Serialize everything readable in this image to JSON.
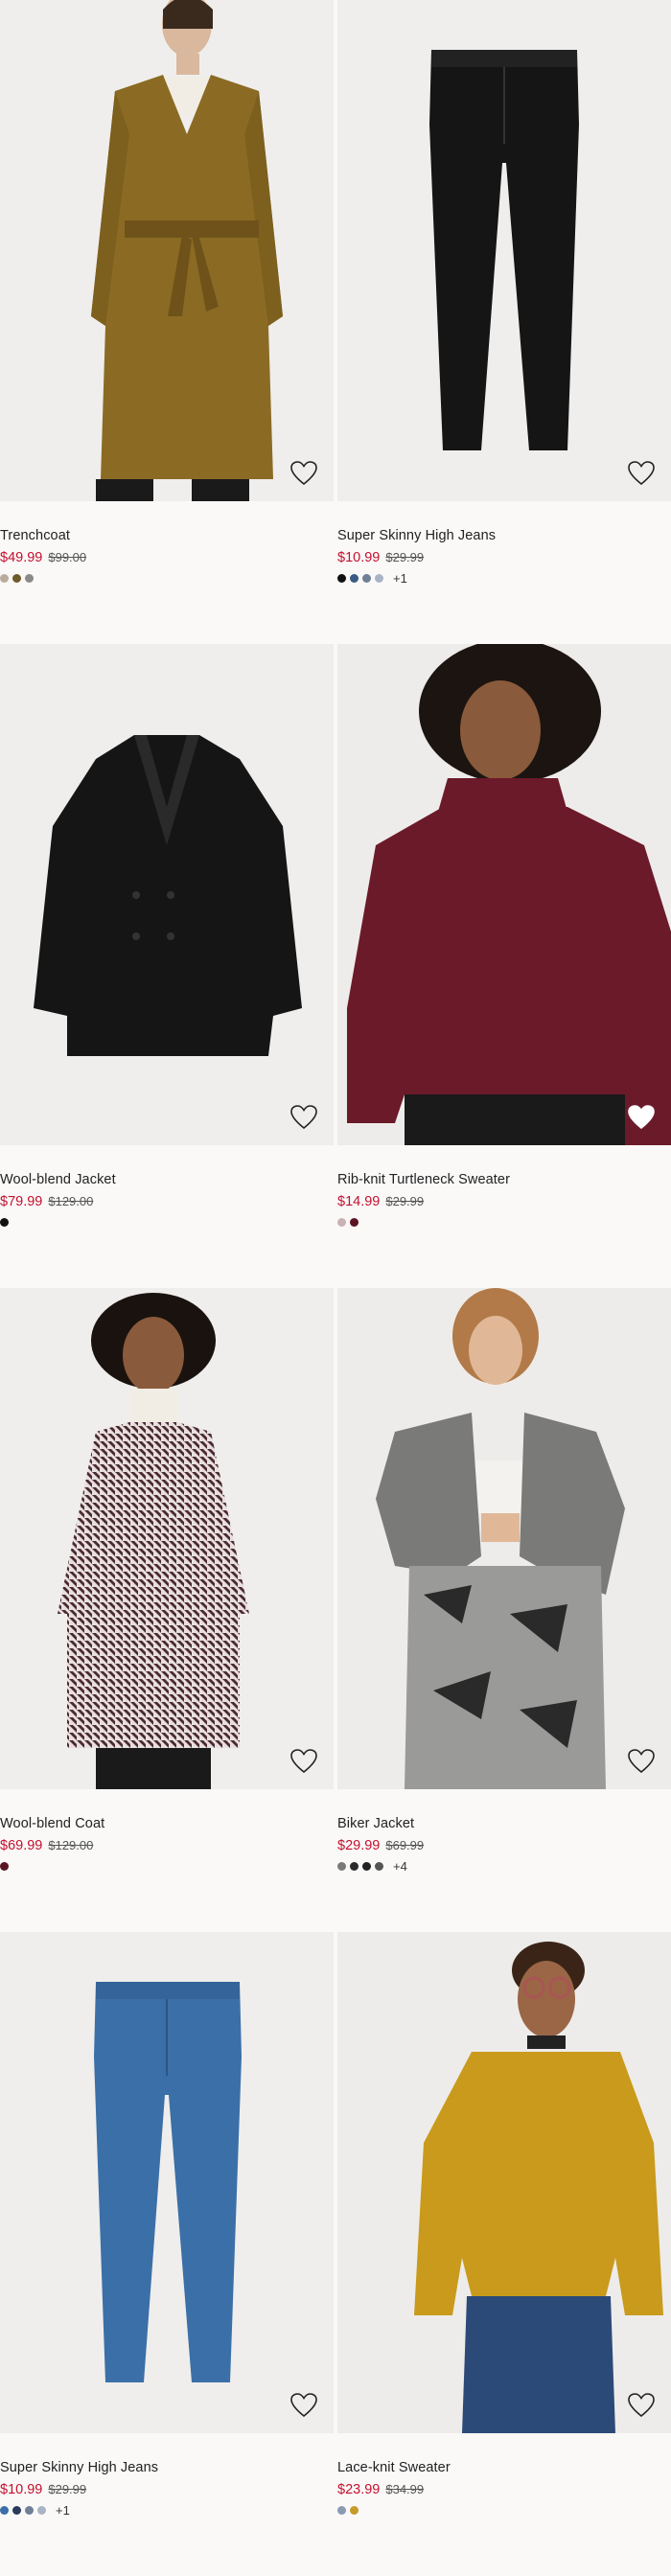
{
  "products": [
    {
      "name": "Trenchcoat",
      "price": "$49.99",
      "old_price": "$99.00",
      "swatches": [
        "#b9ac9c",
        "#6f5a2a",
        "#8a8a86"
      ],
      "more": "",
      "favorited": false,
      "image": "trenchcoat-model-image"
    },
    {
      "name": "Super Skinny High Jeans",
      "price": "$10.99",
      "old_price": "$29.99",
      "swatches": [
        "#111111",
        "#3b5a85",
        "#6f7f96",
        "#a9b4c6"
      ],
      "more": "+1",
      "favorited": false,
      "image": "black-jeans-image"
    },
    {
      "name": "Wool-blend Jacket",
      "price": "$79.99",
      "old_price": "$129.00",
      "swatches": [
        "#111111"
      ],
      "more": "",
      "favorited": false,
      "image": "black-wool-jacket-image"
    },
    {
      "name": "Rib-knit Turtleneck Sweater",
      "price": "$14.99",
      "old_price": "$29.99",
      "swatches": [
        "#c9b2b6",
        "#5a1422"
      ],
      "more": "",
      "favorited": true,
      "image": "burgundy-sweater-model-image"
    },
    {
      "name": "Wool-blend Coat",
      "price": "$69.99",
      "old_price": "$129.00",
      "swatches": [
        "#5a1422"
      ],
      "more": "",
      "favorited": false,
      "image": "houndstooth-coat-model-image"
    },
    {
      "name": "Biker Jacket",
      "price": "$29.99",
      "old_price": "$69.99",
      "swatches": [
        "#7a7a7a",
        "#2a2a2a",
        "#222222",
        "#555555"
      ],
      "more": "+4",
      "favorited": false,
      "image": "grey-biker-jacket-model-image"
    },
    {
      "name": "Super Skinny High Jeans",
      "price": "$10.99",
      "old_price": "$29.99",
      "swatches": [
        "#3b6fa8",
        "#2a3a5c",
        "#6f7f96",
        "#a9b4c6"
      ],
      "more": "+1",
      "favorited": false,
      "image": "blue-jeans-image"
    },
    {
      "name": "Lace-knit Sweater",
      "price": "$23.99",
      "old_price": "$34.99",
      "swatches": [
        "#8a9bb3",
        "#c89a2a"
      ],
      "more": "",
      "favorited": false,
      "image": "mustard-sweater-model-image"
    }
  ]
}
